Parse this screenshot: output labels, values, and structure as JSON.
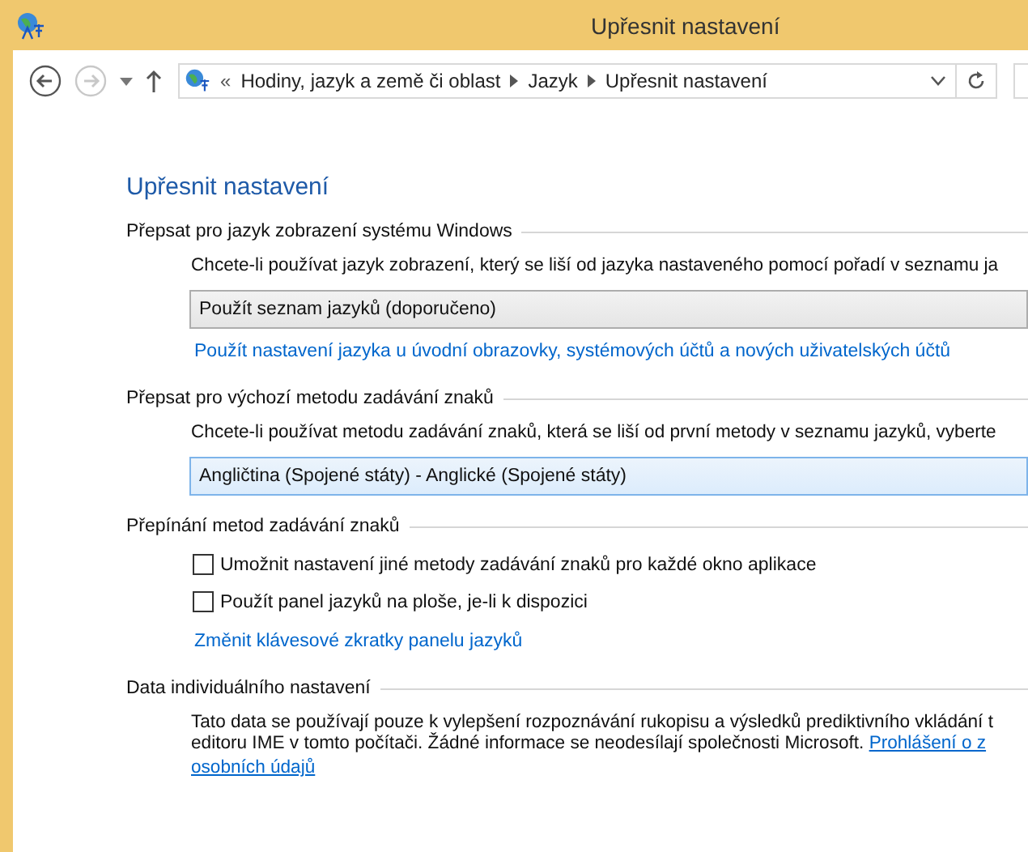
{
  "window": {
    "title": "Upřesnit nastavení"
  },
  "address_bar": {
    "overflow": "«",
    "crumbs": [
      "Hodiny, jazyk a země či oblast",
      "Jazyk",
      "Upřesnit nastavení"
    ]
  },
  "heading": "Upřesnit nastavení",
  "sections": [
    {
      "title": "Přepsat pro jazyk zobrazení systému Windows",
      "items": [
        {
          "kind": "text",
          "text": "Chcete-li používat jazyk zobrazení, který se liší od jazyka nastaveného pomocí pořadí v seznamu ja"
        },
        {
          "kind": "dropdown",
          "value": "Použít seznam jazyků (doporučeno)",
          "focused": false
        },
        {
          "kind": "link",
          "text": "Použít nastavení jazyka u úvodní obrazovky, systémových účtů a nových uživatelských účtů"
        }
      ]
    },
    {
      "title": "Přepsat pro výchozí metodu zadávání znaků",
      "items": [
        {
          "kind": "text",
          "text": "Chcete-li používat metodu zadávání znaků, která se liší od první metody v seznamu jazyků, vyberte"
        },
        {
          "kind": "dropdown",
          "value": "Angličtina (Spojené státy) - Anglické (Spojené státy)",
          "focused": true
        }
      ]
    },
    {
      "title": "Přepínání metod zadávání znaků",
      "items": [
        {
          "kind": "checkbox",
          "label": "Umožnit nastavení jiné metody zadávání znaků pro každé okno aplikace",
          "checked": false
        },
        {
          "kind": "checkbox",
          "label": "Použít panel jazyků na ploše, je-li k dispozici",
          "checked": false
        },
        {
          "kind": "link",
          "text": "Změnit klávesové zkratky panelu jazyků"
        }
      ]
    },
    {
      "title": "Data individuálního nastavení",
      "items": [
        {
          "kind": "text",
          "text": "Tato data se používají pouze k vylepšení rozpoznávání rukopisu a výsledků prediktivního vkládání t"
        },
        {
          "kind": "textlink",
          "text": "editoru IME v tomto počítači. Žádné informace se neodesílají společnosti Microsoft.",
          "link": "Prohlášení o z"
        },
        {
          "kind": "underlined",
          "text": "osobních údajů"
        }
      ]
    }
  ]
}
